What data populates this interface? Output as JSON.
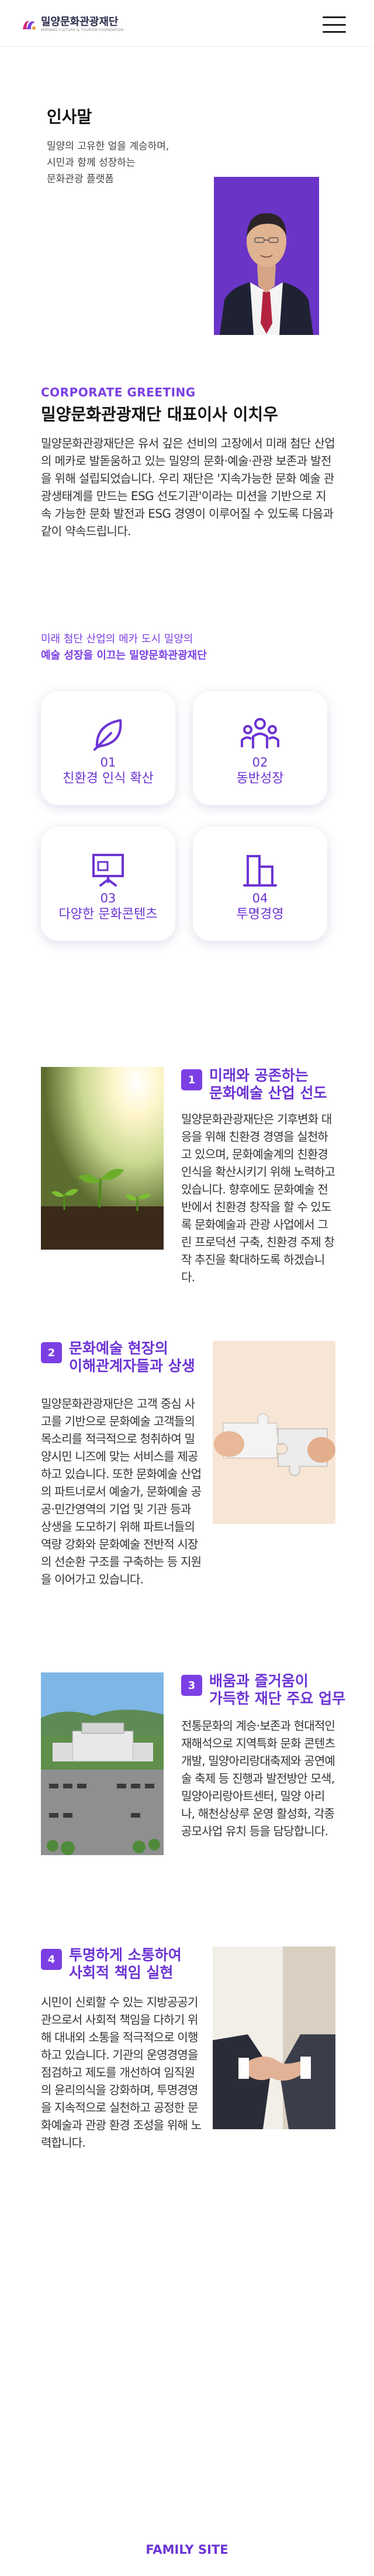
{
  "header": {
    "logo_text": "밀양문화관광재단",
    "logo_subtext": "MIRYANG CULTURE & TOURISM FOUNDATION",
    "menu_icon": "hamburger-menu-icon"
  },
  "intro": {
    "title": "인사말",
    "subtitle": "밀양의 고유한 얼을 계승하며,\n시민과 함께 성장하는\n문화관광 플랫폼"
  },
  "greeting": {
    "label": "CORPORATE GREETING",
    "title": "밀양문화관광재단 대표이사 이치우",
    "paragraphs": [
      "밀양문화관광재단은 유서 깊은 선비의 고장에서 미래 첨단 산업의 메카로 발돋움하고 있는 밀양의 문화·예술·관광 보존과 발전을 위해 설립되었습니다. 우리 재단은 '지속가능한 문화 예술 관광생태계를 만드는 ESG 선도기관'이라는 미션을 기반으로 지속 가능한 문화 발전과 ESG 경영이 이루어질 수 있도록 다음과 같이 약속드립니다."
    ]
  },
  "vision": {
    "line1": "미래 첨단 산업의 메카 도시 밀양의",
    "line2": "예술 성장을 이끄는 밀양문화관광재단"
  },
  "values": [
    {
      "num": "01",
      "label": "친환경 인식 확산",
      "icon": "leaf-icon"
    },
    {
      "num": "02",
      "label": "동반성장",
      "icon": "people-icon"
    },
    {
      "num": "03",
      "label": "다양한 문화콘텐츠",
      "icon": "presentation-icon"
    },
    {
      "num": "04",
      "label": "투명경영",
      "icon": "building-icon"
    }
  ],
  "features": [
    {
      "num": "1",
      "title_line1": "미래와 공존하는",
      "title_line2": "문화예술 산업 선도",
      "body": "밀양문화관광재단은 기후변화 대응을 위해 친환경 경영을 실천하고 있으며, 문화예술계의 친환경 인식을 확산시키기 위해 노력하고 있습니다. 향후에도 문화예술 전반에서 친환경 창작을 할 수 있도록 문화예술과 관광 사업에서 그린 프로덕션 구축, 친환경 주제 창작 추진을 확대하도록 하겠습니다.",
      "image": "sprouts-photo"
    },
    {
      "num": "2",
      "title_line1": "문화예술 현장의",
      "title_line2": "이해관계자들과 상생",
      "body": "밀양문화관광재단은 고객 중심 사고를 기반으로 문화예술 고객들의 목소리를 적극적으로 청취하여 밀양시민 니즈에 맞는 서비스를 제공하고 있습니다. 또한 문화예술 산업의 파트너로서 예술가, 문화예술 공공·민간영역의 기업 및 기관 등과 상생을 도모하기 위해 파트너들의 역량 강화와 문화예술 전반적 시장의 선순환 구조를 구축하는 등 지원을 이어가고 있습니다.",
      "image": "puzzle-photo"
    },
    {
      "num": "3",
      "title_line1": "배움과 즐거움이",
      "title_line2": "가득한 재단 주요 업무",
      "body": "전통문화의 계승·보존과 현대적인 재해석으로 지역특화 문화 콘텐츠 개발, 밀양아리랑대축제와 공연예술 축제 등 진행과 발전방안 모색, 밀양아리랑아트센터, 밀양 아리나, 해천상상루 운영 활성화, 각종 공모사업 유치 등을 담당합니다.",
      "image": "cityhall-photo"
    },
    {
      "num": "4",
      "title_line1": "투명하게 소통하여",
      "title_line2": "사회적 책임 실현",
      "body": "시민이 신뢰할 수 있는 지방공공기관으로서 사회적 책임을 다하기 위해 대내외 소통을 적극적으로 이행하고 있습니다. 기관의 운영경영을 점검하고 제도를 개선하여 임직원의 윤리의식을 강화하며, 투명경영을 지속적으로 실천하고 공정한 문화예술과 관광 환경 조성을 위해 노력합니다.",
      "image": "handshake-photo"
    }
  ],
  "footer": {
    "family_site": "FAMILY SITE"
  },
  "colors": {
    "accent": "#6c34d4",
    "accent_light": "#7b3fe4",
    "ceo_bg": "#6a34c7"
  }
}
